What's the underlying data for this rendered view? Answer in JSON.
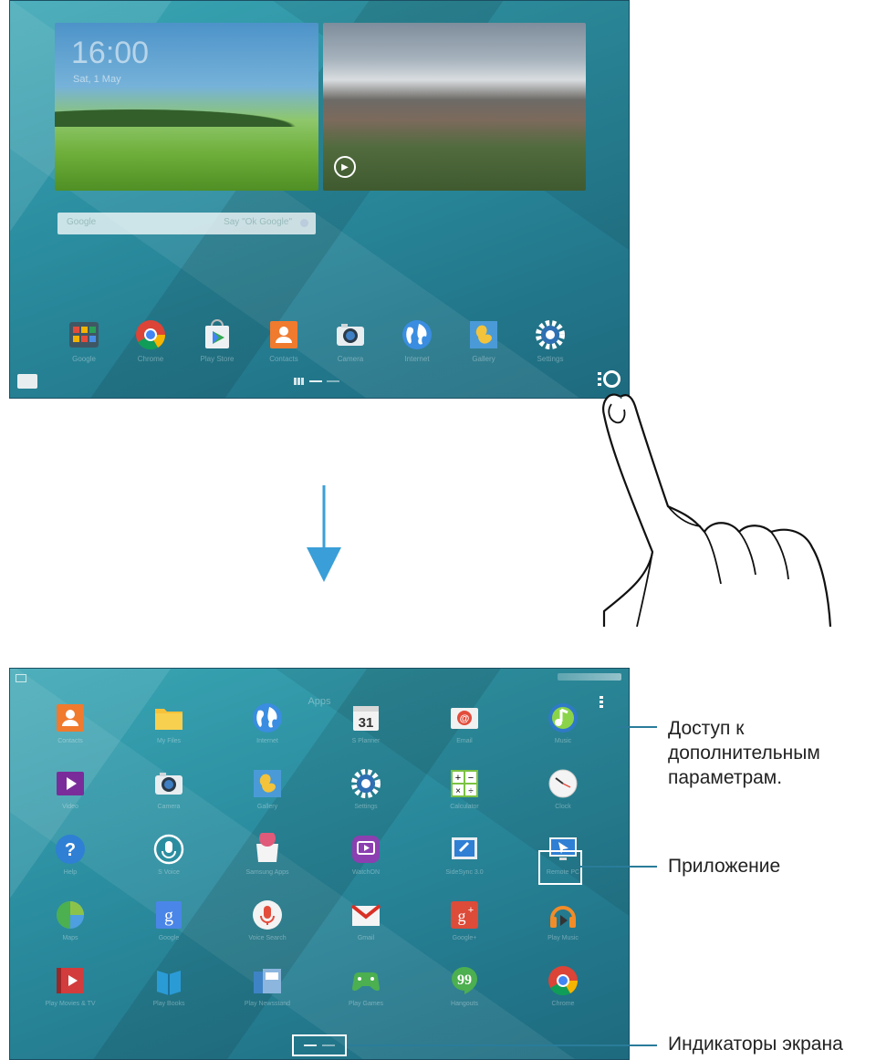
{
  "home": {
    "widgets": {
      "clock_time": "16:00",
      "clock_date": "Sat, 1 May",
      "search_text": "Google",
      "voice_text": "Say \"Ok Google\""
    },
    "dock": [
      {
        "label": "Google",
        "icon": "google-folder-icon"
      },
      {
        "label": "Chrome",
        "icon": "chrome-icon"
      },
      {
        "label": "Play Store",
        "icon": "play-store-icon"
      },
      {
        "label": "Contacts",
        "icon": "contacts-icon"
      },
      {
        "label": "Camera",
        "icon": "camera-icon"
      },
      {
        "label": "Internet",
        "icon": "internet-icon"
      },
      {
        "label": "Gallery",
        "icon": "gallery-icon"
      },
      {
        "label": "Settings",
        "icon": "settings-icon"
      }
    ]
  },
  "apps": {
    "title": "Apps",
    "grid": [
      {
        "label": "Contacts",
        "icon": "contacts-icon"
      },
      {
        "label": "My Files",
        "icon": "my-files-icon"
      },
      {
        "label": "Internet",
        "icon": "internet-icon"
      },
      {
        "label": "S Planner",
        "icon": "calendar-icon"
      },
      {
        "label": "Email",
        "icon": "email-icon"
      },
      {
        "label": "Music",
        "icon": "music-icon"
      },
      {
        "label": "Video",
        "icon": "video-icon"
      },
      {
        "label": "Camera",
        "icon": "camera-icon"
      },
      {
        "label": "Gallery",
        "icon": "gallery-icon"
      },
      {
        "label": "Settings",
        "icon": "settings-icon"
      },
      {
        "label": "Calculator",
        "icon": "calculator-icon"
      },
      {
        "label": "Clock",
        "icon": "clock-icon"
      },
      {
        "label": "Help",
        "icon": "help-icon"
      },
      {
        "label": "S Voice",
        "icon": "s-voice-icon"
      },
      {
        "label": "Samsung Apps",
        "icon": "samsung-apps-icon"
      },
      {
        "label": "WatchON",
        "icon": "watchon-icon"
      },
      {
        "label": "SideSync 3.0",
        "icon": "sidesync-icon"
      },
      {
        "label": "Remote PC",
        "icon": "remote-pc-icon"
      },
      {
        "label": "Maps",
        "icon": "maps-icon"
      },
      {
        "label": "Google",
        "icon": "google-search-icon"
      },
      {
        "label": "Voice Search",
        "icon": "voice-search-icon"
      },
      {
        "label": "Gmail",
        "icon": "gmail-icon"
      },
      {
        "label": "Google+",
        "icon": "google-plus-icon"
      },
      {
        "label": "Play Music",
        "icon": "play-music-icon"
      },
      {
        "label": "Play Movies & TV",
        "icon": "play-movies-icon"
      },
      {
        "label": "Play Books",
        "icon": "play-books-icon"
      },
      {
        "label": "Play Newsstand",
        "icon": "play-newsstand-icon"
      },
      {
        "label": "Play Games",
        "icon": "play-games-icon"
      },
      {
        "label": "Hangouts",
        "icon": "hangouts-icon"
      },
      {
        "label": "Chrome",
        "icon": "chrome-icon"
      }
    ]
  },
  "callouts": {
    "more_options_line1": "Доступ к",
    "more_options_line2": "дополнительным",
    "more_options_line3": "параметрам.",
    "app": "Приложение",
    "screen_indicators": "Индикаторы экрана"
  },
  "colors": {
    "callout_line": "#2a7c9a",
    "arrow": "#3a9fd8",
    "wallpaper": "#2b8ea0"
  }
}
